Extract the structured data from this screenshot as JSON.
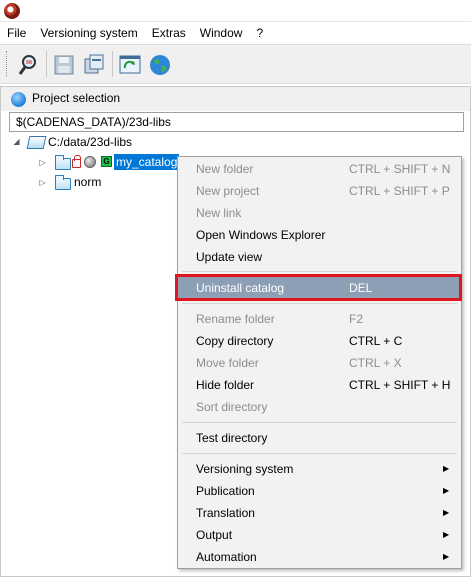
{
  "menubar": [
    "File",
    "Versioning system",
    "Extras",
    "Window",
    "?"
  ],
  "toolbar_icons": [
    "search-icon",
    "save-icon",
    "copy-icon",
    "refresh-icon",
    "globe-icon"
  ],
  "panel": {
    "title": "Project selection",
    "path": "$(CADENAS_DATA)/23d-libs"
  },
  "tree": {
    "root": "C:/data/23d-libs",
    "my_catalog": "my_catalog",
    "norm": "norm"
  },
  "context_menu": {
    "items": [
      {
        "label": "New folder",
        "shortcut": "CTRL + SHIFT + N",
        "enabled": false
      },
      {
        "label": "New project",
        "shortcut": "CTRL + SHIFT + P",
        "enabled": false
      },
      {
        "label": "New link",
        "shortcut": "",
        "enabled": false
      },
      {
        "label": "Open Windows Explorer",
        "shortcut": "",
        "enabled": true
      },
      {
        "label": "Update view",
        "shortcut": "",
        "enabled": true
      },
      {
        "label": "Uninstall catalog",
        "shortcut": "DEL",
        "enabled": true,
        "highlighted": true
      },
      {
        "label": "Rename folder",
        "shortcut": "F2",
        "enabled": false
      },
      {
        "label": "Copy directory",
        "shortcut": "CTRL + C",
        "enabled": true
      },
      {
        "label": "Move folder",
        "shortcut": "CTRL + X",
        "enabled": false
      },
      {
        "label": "Hide folder",
        "shortcut": "CTRL + SHIFT + H",
        "enabled": true
      },
      {
        "label": "Sort directory",
        "shortcut": "",
        "enabled": false
      },
      {
        "label": "Test directory",
        "shortcut": "",
        "enabled": true
      },
      {
        "label": "Versioning system",
        "shortcut": "",
        "enabled": true,
        "submenu": true
      },
      {
        "label": "Publication",
        "shortcut": "",
        "enabled": true,
        "submenu": true
      },
      {
        "label": "Translation",
        "shortcut": "",
        "enabled": true,
        "submenu": true
      },
      {
        "label": "Output",
        "shortcut": "",
        "enabled": true,
        "submenu": true
      },
      {
        "label": "Automation",
        "shortcut": "",
        "enabled": true,
        "submenu": true
      }
    ]
  },
  "colors": {
    "selection": "#0078d7",
    "menu_highlight": "#8c9fb5",
    "annotation_box": "#e0161e"
  }
}
